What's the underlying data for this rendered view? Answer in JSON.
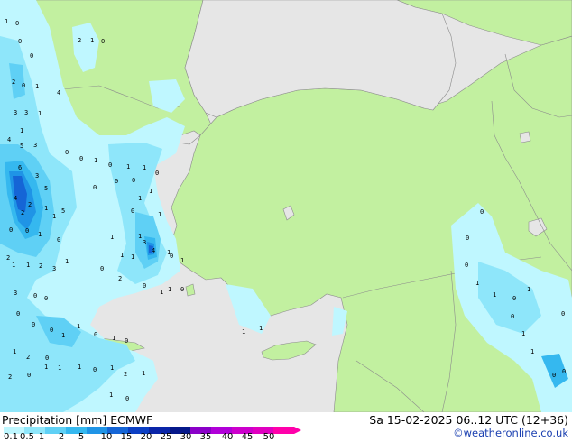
{
  "title": "Precipitation [mm]",
  "model": "ECMWF",
  "valid_time": "Sa 15-02-2025 06..12 UTC (12+36)",
  "credit": "©weatheronline.co.uk",
  "colors": {
    "sea": "#e6e6e6",
    "land": "#c2f0a0",
    "border": "#8c8c8c"
  },
  "legend": {
    "ticks": [
      "0.1",
      "0.5",
      "1",
      "2",
      "5",
      "10",
      "15",
      "20",
      "25",
      "30",
      "35",
      "40",
      "45",
      "50"
    ],
    "colors": [
      "#bff7ff",
      "#8ee6fa",
      "#5fd0f5",
      "#35b8ef",
      "#1f94e6",
      "#1565d6",
      "#0c3fc4",
      "#0a25a8",
      "#06188a",
      "#8a00c8",
      "#b000d8",
      "#cc00cc",
      "#e000c0",
      "#ff00aa"
    ]
  },
  "point_labels": [
    "1",
    "0",
    "0",
    "0",
    "2",
    "1",
    "0",
    "2",
    "0",
    "1",
    "4",
    "3",
    "3",
    "1",
    "1",
    "4",
    "5",
    "3",
    "6",
    "3",
    "5",
    "4",
    "2",
    "1",
    "2",
    "1",
    "5",
    "0",
    "0",
    "1",
    "0",
    "2",
    "1",
    "1",
    "2",
    "3",
    "1",
    "3",
    "0",
    "0",
    "0",
    "0",
    "0",
    "1",
    "1",
    "0",
    "1",
    "0",
    "1",
    "2",
    "0",
    "0",
    "1",
    "1",
    "1",
    "0",
    "1",
    "2",
    "1",
    "2",
    "1",
    "0",
    "0",
    "0",
    "1",
    "0",
    "1",
    "1",
    "0",
    "0",
    "0",
    "0",
    "1",
    "1",
    "0",
    "1",
    "1",
    "3",
    "4",
    "1",
    "1",
    "1",
    "1",
    "0",
    "2",
    "0",
    "1",
    "1",
    "0",
    "0",
    "1",
    "1",
    "1",
    "0",
    "0",
    "0",
    "1",
    "1",
    "0",
    "1",
    "0",
    "1",
    "1",
    "0",
    "0",
    "0"
  ]
}
